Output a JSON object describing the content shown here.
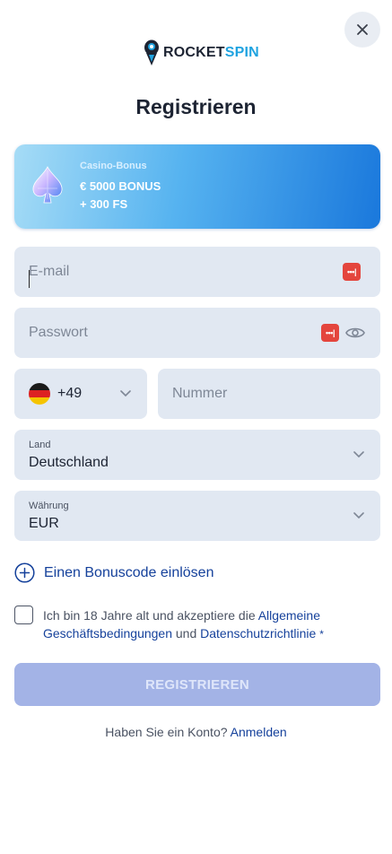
{
  "header": {
    "brand_part1": "ROCKET",
    "brand_part2": "SPIN"
  },
  "page_title": "Registrieren",
  "bonus": {
    "kicker": "Casino-Bonus",
    "line1": "€ 5000 BONUS",
    "line2": "+ 300 FS"
  },
  "form": {
    "email_placeholder": "E-mail",
    "password_placeholder": "Passwort",
    "phone_code": "+49",
    "number_placeholder": "Nummer",
    "country_label": "Land",
    "country_value": "Deutschland",
    "currency_label": "Währung",
    "currency_value": "EUR",
    "password_manager_glyph": "•••|"
  },
  "bonus_code_link": "Einen Bonuscode einlösen",
  "terms": {
    "text_before": "Ich bin 18 Jahre alt und akzeptiere die ",
    "link1": "Allgemeine Geschäftsbedingungen",
    "text_between": " und ",
    "link2": "Datenschutzrichtlinie",
    "required_mark": "*"
  },
  "register_button": "REGISTRIEREN",
  "login": {
    "prompt": "Haben Sie ein Konto? ",
    "link": "Anmelden"
  },
  "colors": {
    "accent_link": "#15419b",
    "field_bg": "#e1e8f2",
    "button_disabled": "#a3b3e6",
    "brand_blue": "#1fa3e0"
  },
  "icons": [
    "close-icon",
    "rocket-logo-icon",
    "diamond-spade-icon",
    "password-manager-icon",
    "eye-icon",
    "germany-flag-icon",
    "chevron-down-icon",
    "plus-circle-icon"
  ]
}
